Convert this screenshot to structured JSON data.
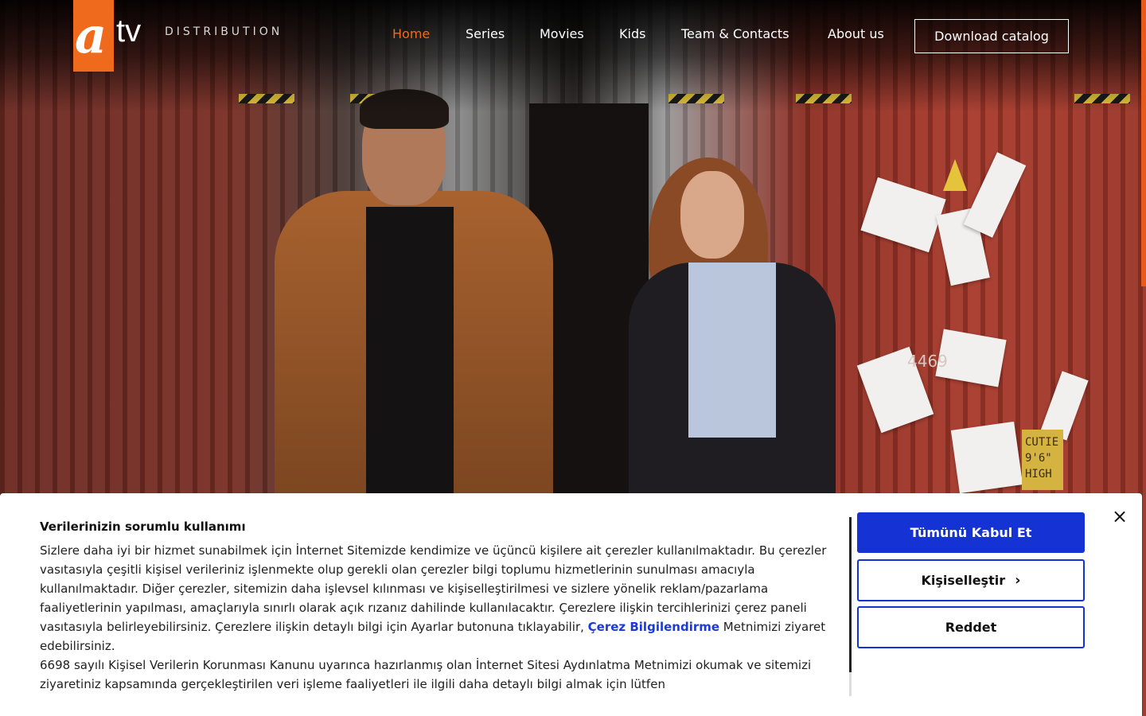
{
  "header": {
    "logo_mark": "a",
    "logo_tv": "tv",
    "logo_sub": "DISTRIBUTION",
    "nav": [
      {
        "label": "Home",
        "active": true
      },
      {
        "label": "Series"
      },
      {
        "label": "Movies"
      },
      {
        "label": "Kids"
      },
      {
        "label": "Team & Contacts"
      },
      {
        "label": "About us"
      }
    ],
    "catalog_button": "Download catalog"
  },
  "hero": {
    "poster_text_cutie": "CUTIE 9'6\" HIGH",
    "container_numbers": "4469"
  },
  "cookie_banner": {
    "title": "Verilerinizin sorumlu kullanımı",
    "paragraph_1_start": "Sizlere daha iyi bir hizmet sunabilmek için İnternet Sitemizde kendimize ve üçüncü kişilere ait çerezler kullanılmaktadır. Bu çerezler vasıtasıyla çeşitli kişisel verileriniz işlenmekte olup gerekli olan çerezler bilgi toplumu hizmetlerinin sunulması amacıyla kullanılmaktadır. Diğer çerezler, sitemizin daha işlevsel kılınması ve kişiselleştirilmesi ve sizlere yönelik reklam/pazarlama faaliyetlerinin yapılması, amaçlarıyla sınırlı olarak açık rızanız dahilinde kullanılacaktır. Çerezlere ilişkin tercihlerinizi çerez paneli vasıtasıyla belirleyebilirsiniz. Çerezlere ilişkin detaylı bilgi için Ayarlar butonuna tıklayabilir, ",
    "link_text": "Çerez Bilgilendirme",
    "paragraph_1_end": " Metnimizi ziyaret edebilirsiniz.",
    "paragraph_2": "6698 sayılı Kişisel Verilerin Korunması Kanunu uyarınca hazırlanmış olan İnternet Sitesi Aydınlatma Metnimizi okumak ve sitemizi ziyaretiniz kapsamında gerçekleştirilen veri işleme faaliyetleri ile ilgili daha detaylı bilgi almak için lütfen",
    "accept_label": "Tümünü Kabul Et",
    "customize_label": "Kişiselleştir",
    "reject_label": "Reddet",
    "close_symbol": "×"
  },
  "colors": {
    "brand_orange": "#ef6a1d",
    "accept_blue": "#1533d4"
  }
}
